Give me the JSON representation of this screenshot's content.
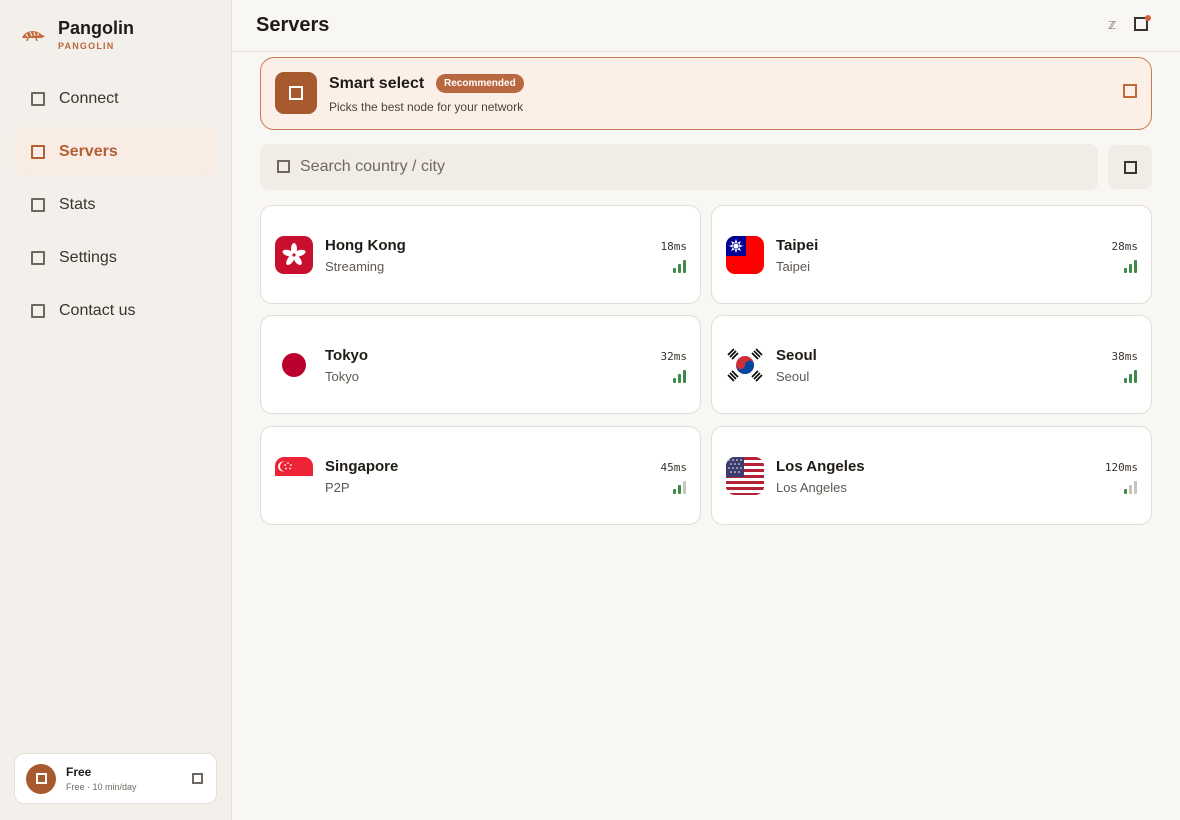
{
  "brand": {
    "name": "Pangolin",
    "sub": "PANGOLIN"
  },
  "nav": [
    {
      "id": "connect",
      "label": "Connect",
      "active": false
    },
    {
      "id": "servers",
      "label": "Servers",
      "active": true
    },
    {
      "id": "stats",
      "label": "Stats",
      "active": false
    },
    {
      "id": "settings",
      "label": "Settings",
      "active": false
    },
    {
      "id": "contact",
      "label": "Contact us",
      "active": false
    }
  ],
  "plan": {
    "title": "Free",
    "subtitle": "Free · 10 min/day"
  },
  "header": {
    "title": "Servers",
    "glyph": "ℤ"
  },
  "smart": {
    "title": "Smart select",
    "badge": "Recommended",
    "description": "Picks the best node for your network"
  },
  "search": {
    "placeholder": "Search country / city",
    "value": ""
  },
  "servers": [
    {
      "city": "Hong Kong",
      "tag": "Streaming",
      "ping": "18ms",
      "flag": "hk",
      "signal": 3
    },
    {
      "city": "Taipei",
      "tag": "Taipei",
      "ping": "28ms",
      "flag": "tw",
      "signal": 3
    },
    {
      "city": "Tokyo",
      "tag": "Tokyo",
      "ping": "32ms",
      "flag": "jp",
      "signal": 3
    },
    {
      "city": "Seoul",
      "tag": "Seoul",
      "ping": "38ms",
      "flag": "kr",
      "signal": 3
    },
    {
      "city": "Singapore",
      "tag": "P2P",
      "ping": "45ms",
      "flag": "sg",
      "signal": 2
    },
    {
      "city": "Los Angeles",
      "tag": "Los Angeles",
      "ping": "120ms",
      "flag": "us",
      "signal": 1
    }
  ],
  "colors": {
    "accent": "#b45f36",
    "signal": "#3e8a4a",
    "signal_dim": "#c9c3bb"
  }
}
